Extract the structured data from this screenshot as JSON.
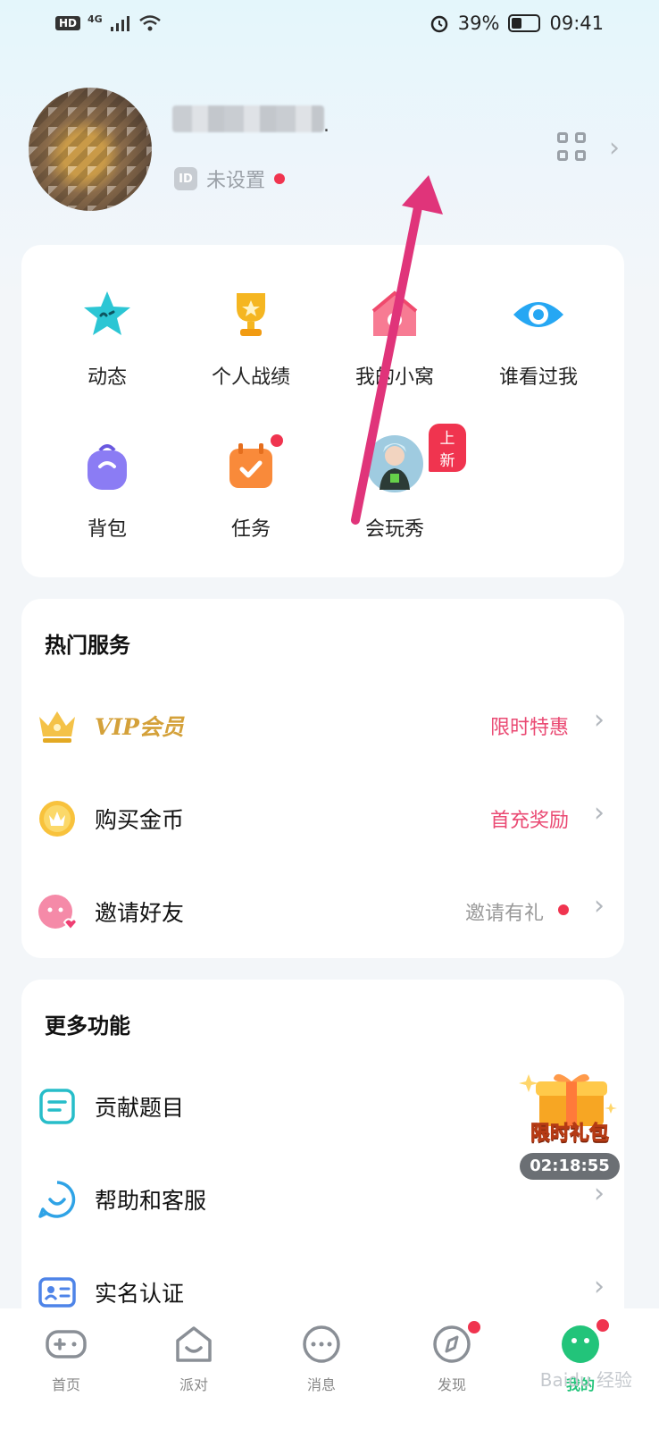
{
  "status_bar": {
    "hd": "HD",
    "network": "4G",
    "battery_text": "39%",
    "time": "09:41"
  },
  "profile": {
    "name_suffix": ".",
    "id_badge": "ID",
    "id_value": "未设置"
  },
  "shortcuts": [
    {
      "label": "动态",
      "icon": "star-icon",
      "color": "#2cc6d4"
    },
    {
      "label": "个人战绩",
      "icon": "trophy-icon",
      "color": "#f5b621"
    },
    {
      "label": "我的小窝",
      "icon": "house-icon",
      "color": "#f77b93"
    },
    {
      "label": "谁看过我",
      "icon": "eye-icon",
      "color": "#26a7f3"
    },
    {
      "label": "背包",
      "icon": "backpack-icon",
      "color": "#8b7cf4"
    },
    {
      "label": "任务",
      "icon": "calendar-check-icon",
      "color": "#f98a3a"
    },
    {
      "label": "会玩秀",
      "icon": "avatar-show-icon",
      "color": "#7bb7d6"
    }
  ],
  "shortcut_badge": "上新",
  "hot_services": {
    "title": "热门服务",
    "rows": [
      {
        "label": "VIP会员",
        "hint": "限时特惠",
        "hint_color": "#ea4a73",
        "icon": "crown-icon"
      },
      {
        "label": "购买金币",
        "hint": "首充奖励",
        "hint_color": "#ea4a73",
        "icon": "coin-icon"
      },
      {
        "label": "邀请好友",
        "hint": "邀请有礼",
        "hint_color": "#999999",
        "icon": "invite-friend-icon"
      }
    ]
  },
  "more_features": {
    "title": "更多功能",
    "rows": [
      {
        "label": "贡献题目",
        "icon": "document-icon"
      },
      {
        "label": "帮助和客服",
        "icon": "smile-chat-icon"
      },
      {
        "label": "实名认证",
        "icon": "id-card-icon"
      }
    ]
  },
  "gift": {
    "label": "限时礼包",
    "timer": "02:18:55"
  },
  "bottom_nav": [
    {
      "label": "首页",
      "icon": "gamepad-icon"
    },
    {
      "label": "派对",
      "icon": "party-icon"
    },
    {
      "label": "消息",
      "icon": "message-icon"
    },
    {
      "label": "发现",
      "icon": "compass-icon"
    },
    {
      "label": "我的",
      "icon": "me-icon"
    }
  ],
  "watermark": "Baidu 经验",
  "colors": {
    "accent_pink": "#ea4a73",
    "active_green": "#22c47a",
    "annotation_arrow": "#e0347a"
  }
}
